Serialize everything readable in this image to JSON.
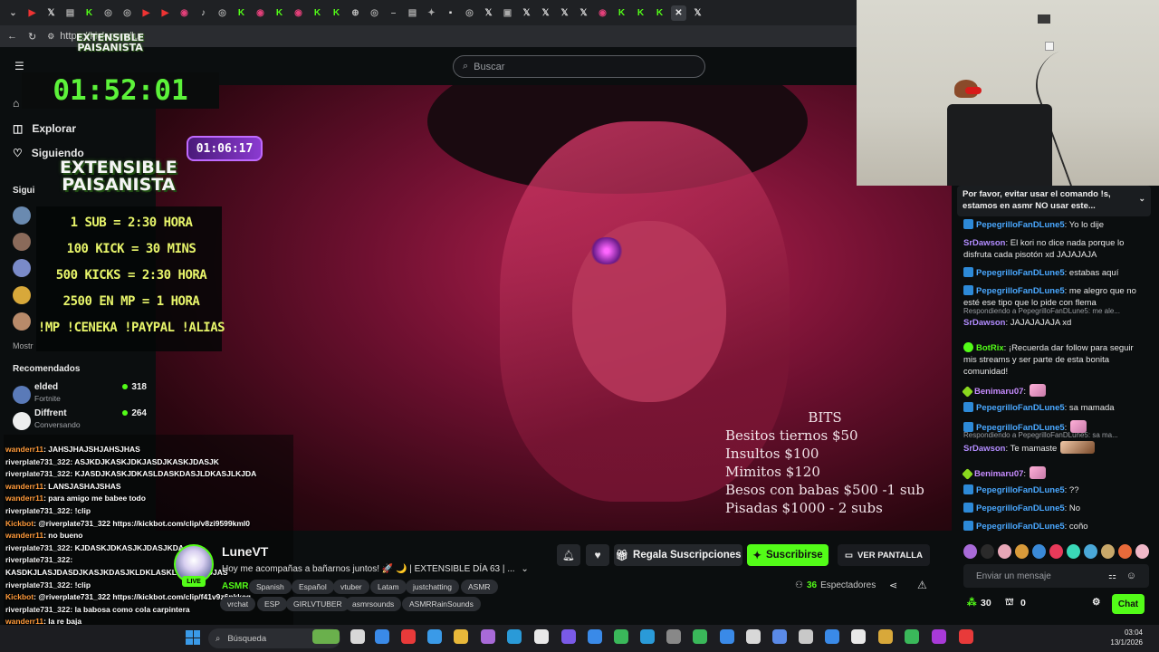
{
  "browser": {
    "url": "https://kick.com/lu"
  },
  "kick": {
    "search_placeholder": "Buscar",
    "nav": {
      "explore": "Explorar",
      "following": "Siguiendo",
      "section_following_short": "Sigui",
      "show_more_short": "Mostr"
    },
    "recommended_title": "Recomendados",
    "recommended": [
      {
        "name": "elded",
        "category": "Fortnite",
        "viewers": "318"
      },
      {
        "name": "Diffrent",
        "category": "Conversando",
        "viewers": "264"
      }
    ]
  },
  "overlay": {
    "timer": "01:52:01",
    "small_logo": [
      "EXTENSIBLE",
      "PAISANISTA"
    ],
    "pill_timer": "01:06:17",
    "big_logo": [
      "EXTENSIBLE",
      "PAISANISTA"
    ],
    "rules": [
      "1 SUB = 2:30 HORA",
      "100 KICK = 30 MINS",
      "500 KICKS = 2:30 HORA",
      "2500 EN MP = 1 HORA",
      "!MP !CENEKA !PAYPAL !ALIAS"
    ],
    "bits": {
      "title": "BITS",
      "lines": [
        "Besitos tiernos $50",
        "Insultos $100",
        "Mimitos  $120",
        "Besos con babas $500 -1 sub",
        "Pisadas  $1000 - 2 subs"
      ]
    },
    "chat_lines": [
      {
        "user": "wanderr11",
        "text": ": JAHSJHAJSHJAHSJHAS"
      },
      {
        "user": "riverplate731_322",
        "text": ": ASJKDJKASKJDKJASDJKASKJDASJK"
      },
      {
        "user": "riverplate731_322",
        "text": ": KJASDJKASKJDKASLDASKDASJLDKASJLKJDA"
      },
      {
        "user": "wanderr11",
        "text": ": LANSJASHAJSHAS"
      },
      {
        "user": "wanderr11",
        "text": ": para amigo me babee todo"
      },
      {
        "user": "riverplate731_322",
        "text": ": !clip"
      },
      {
        "user": "Kickbot",
        "text": ": @riverplate731_322 https://kickbot.com/clip/v8zi9599kml0"
      },
      {
        "user": "wanderr11",
        "text": ": no bueno"
      },
      {
        "user": "riverplate731_322",
        "text": ": KJDASKJDKASJKJDASJKDA"
      },
      {
        "user": "riverplate731_322",
        "text": ":"
      },
      {
        "user": "",
        "text": "KASDKJLASJDASDJKASJKDASJKLDKLASKLJDASLKDJAS"
      },
      {
        "user": "riverplate731_322",
        "text": ": !clip"
      },
      {
        "user": "Kickbot",
        "text": ": @riverplate731_322 https://kickbot.com/clip/f41v9z6pkkcq"
      },
      {
        "user": "riverplate731_322",
        "text": ": la babosa como cola carpintera"
      },
      {
        "user": "wanderr11",
        "text": ": la re baja"
      }
    ]
  },
  "stream": {
    "streamer": "LuneVT",
    "live_label": "LIVE",
    "title": "Hoy me acompañas a bañarnos juntos! 🚀 🌙 | EXTENSIBLE DÍA 63 | ...",
    "category": "ASMR",
    "tags_row1": [
      "Spanish",
      "Español",
      "vtuber",
      "Latam",
      "justchatting",
      "ASMR"
    ],
    "tags_row2": [
      "vrchat",
      "ESP",
      "GIRLVTUBER",
      "asmrsounds",
      "ASMRRainSounds"
    ],
    "gift_label": "Regala Suscripciones",
    "subscribe_label": "Suscribirse",
    "screen_label": "VER PANTALLA",
    "viewers_count": "36",
    "viewers_label": "Espectadores"
  },
  "chat": {
    "pinned": "Por favor, evitar usar el comando !s, estamos en asmr NO usar este...",
    "messages": [
      {
        "user": "PepegrilloFanDLune5",
        "text": ": Yo lo dije"
      },
      {
        "user": "SrDawson",
        "text": ": El kori no dice nada porque lo disfruta cada pisotón xd JAJAJAJA"
      },
      {
        "user": "PepegrilloFanDLune5",
        "text": ": estabas aquí"
      },
      {
        "user": "PepegrilloFanDLune5",
        "text": ": me alegro que no esté ese tipo que lo pide con flema"
      },
      {
        "reply": "Respondiendo a PepegrilloFanDLune5: me ale...",
        "user": "SrDawson",
        "text": ": JAJAJAJAJA xd"
      },
      {
        "user": "BotRix",
        "text": ": ¡Recuerda dar follow para seguir mis streams y ser parte de esta bonita comunidad!"
      },
      {
        "user": "Benimaru07",
        "text": ":"
      },
      {
        "user": "PepegrilloFanDLune5",
        "text": ": sa mamada"
      },
      {
        "user": "PepegrilloFanDLune5",
        "text": ":"
      },
      {
        "reply": "Respondiendo a PepegrilloFanDLune5: sa ma...",
        "user": "SrDawson",
        "text": ": Te mamaste"
      },
      {
        "user": "Benimaru07",
        "text": ":"
      },
      {
        "user": "PepegrilloFanDLune5",
        "text": ": ??"
      },
      {
        "user": "PepegrilloFanDLune5",
        "text": ": No"
      },
      {
        "user": "PepegrilloFanDLune5",
        "text": ": coño"
      }
    ],
    "input_placeholder": "Enviar un mensaje",
    "points": "30",
    "gifts": "0",
    "send_label": "Chat"
  },
  "taskbar": {
    "search_placeholder": "Búsqueda",
    "time": "03:04",
    "date": "13/1/2026"
  },
  "colors": {
    "kick_green": "#53fc18",
    "background": "#0b0e0f",
    "username_blue": "#4aa8ff",
    "username_purple": "#b28cff"
  }
}
